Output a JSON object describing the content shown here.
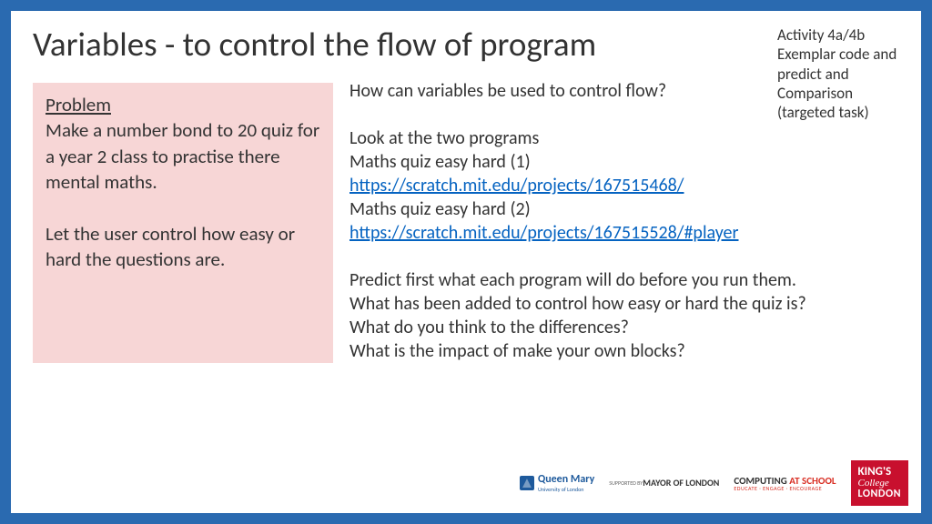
{
  "title": "Variables - to control the flow of program",
  "activity_note": "Activity 4a/4b Exemplar code and predict and Comparison (targeted task)",
  "problem": {
    "heading": "Problem",
    "para1": "Make a number bond to 20 quiz for a year 2 class to practise there mental maths.",
    "para2": "Let the user control how easy or hard the questions are."
  },
  "main": {
    "q1": "How can variables be used to control flow?",
    "look_intro": "Look at the two programs",
    "quiz1_label": "Maths quiz easy hard (1)",
    "quiz1_link": "https://scratch.mit.edu/projects/167515468/",
    "quiz2_label": "Maths quiz easy hard (2)",
    "quiz2_link": "https://scratch.mit.edu/projects/167515528/#player",
    "predict1": "Predict first what each program will do before you run them.",
    "predict2": "What has been added to control how easy or hard the quiz is?",
    "predict3": "What do you think to the differences?",
    "predict4": "What is the impact of make your own blocks?"
  },
  "logos": {
    "qm": "Queen Mary",
    "qm_sub": "University of London",
    "mayor_sup": "SUPPORTED BY",
    "mayor": "MAYOR OF LONDON",
    "cas_comp": "COMPUTING",
    "cas_at": " AT SCHOOL",
    "cas_sub": "EDUCATE · ENGAGE · ENCOURAGE",
    "kcl_kings": "KING'S",
    "kcl_college": "College",
    "kcl_london": "LONDON"
  }
}
